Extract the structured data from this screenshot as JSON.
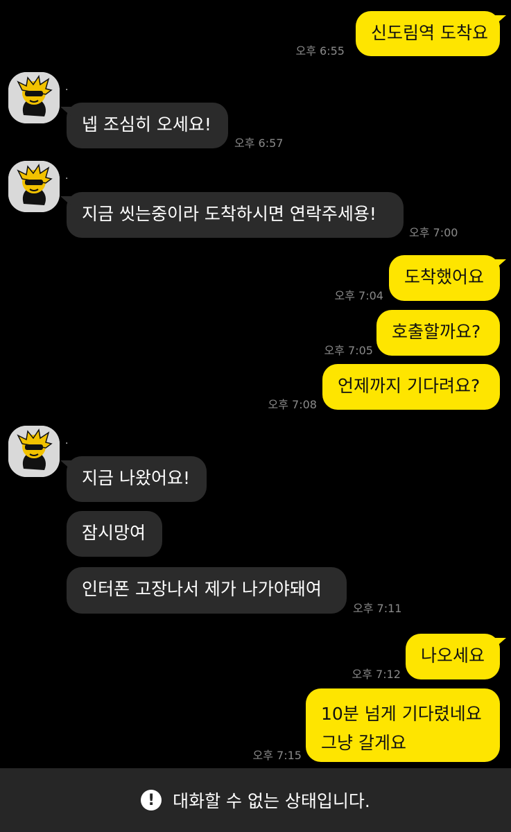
{
  "chat": {
    "sender_name": ".",
    "messages": [
      {
        "dir": "out",
        "text": "신도림역 도착요",
        "time": "오후 6:55"
      },
      {
        "dir": "in",
        "text": "넵 조심히 오세요!",
        "time": "오후 6:57"
      },
      {
        "dir": "in",
        "text": "지금 씻는중이라 도착하시면 연락주세용!",
        "time": "오후 7:00"
      },
      {
        "dir": "out",
        "text": "도착했어요",
        "time": "오후 7:04"
      },
      {
        "dir": "out",
        "text": "호출할까요?",
        "time": "오후 7:05"
      },
      {
        "dir": "out",
        "text": "언제까지 기다려요?",
        "time": "오후 7:08"
      },
      {
        "dir": "in",
        "text": "지금 나왔어요!",
        "time": ""
      },
      {
        "dir": "in",
        "text": "잠시망여",
        "time": ""
      },
      {
        "dir": "in",
        "text": "인터폰 고장나서 제가 나가야돼여",
        "time": "오후 7:11"
      },
      {
        "dir": "out",
        "text": "나오세요",
        "time": "오후 7:12"
      },
      {
        "dir": "out",
        "text_lines": [
          "10분 넘게 기다렸네요",
          "그냥 갈게요"
        ],
        "time": "오후 7:15"
      }
    ]
  },
  "bottom_bar": {
    "icon": "exclamation-circle-icon",
    "icon_glyph": "!",
    "text": "대화할 수 없는 상태입니다."
  },
  "colors": {
    "background": "#000000",
    "outgoing_bubble": "#fee500",
    "incoming_bubble": "#2b2b2b",
    "timestamp": "#8a8a8a",
    "bottom_bar": "#262626"
  }
}
